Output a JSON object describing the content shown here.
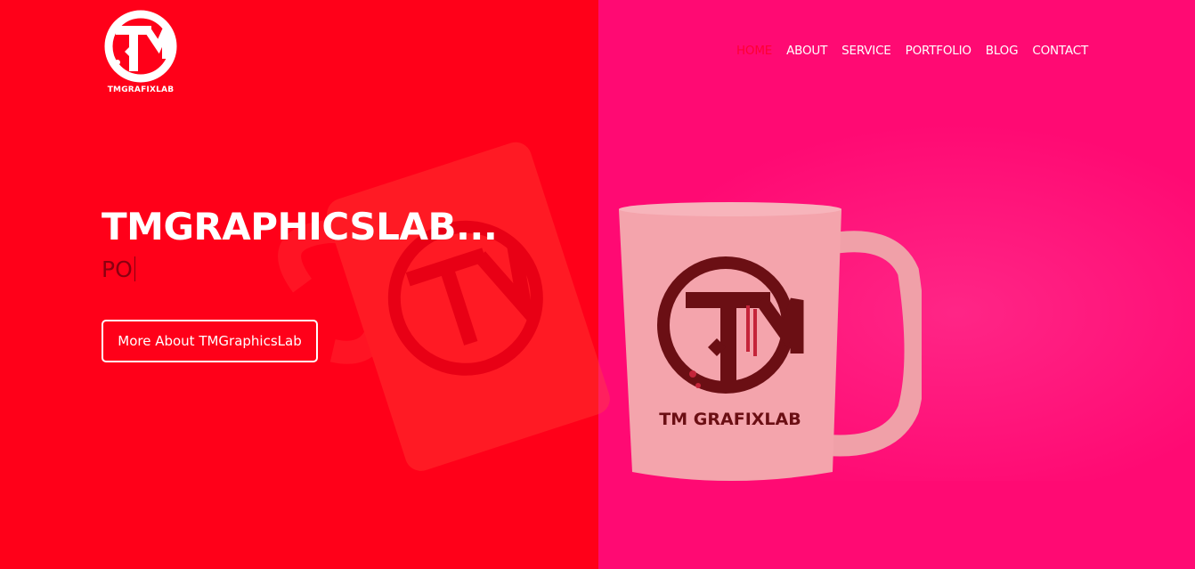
{
  "brand": {
    "logo_text": "TMGRAFIXLAB",
    "mug_logo_text": "TM GRAFIXLAB"
  },
  "nav": {
    "items": [
      {
        "label": "HOME",
        "active": true
      },
      {
        "label": "ABOUT",
        "active": false
      },
      {
        "label": "SERVICE",
        "active": false
      },
      {
        "label": "PORTFOLIO",
        "active": false
      },
      {
        "label": "BLOG",
        "active": false
      },
      {
        "label": "CONTACT",
        "active": false
      }
    ]
  },
  "hero": {
    "headline": "TMGRAPHICSLAB...",
    "typed_text": "PO",
    "cta_label": "More About TMGraphicsLab"
  },
  "colors": {
    "left_bg": "#ff0019",
    "right_bg": "#ff0a73",
    "nav_active": "#ff0033",
    "mug": "#f4a4ac",
    "mug_logo": "#6b0f14"
  },
  "icons": [
    "tm-logo-icon",
    "mug-image",
    "pen-nib-icon"
  ]
}
